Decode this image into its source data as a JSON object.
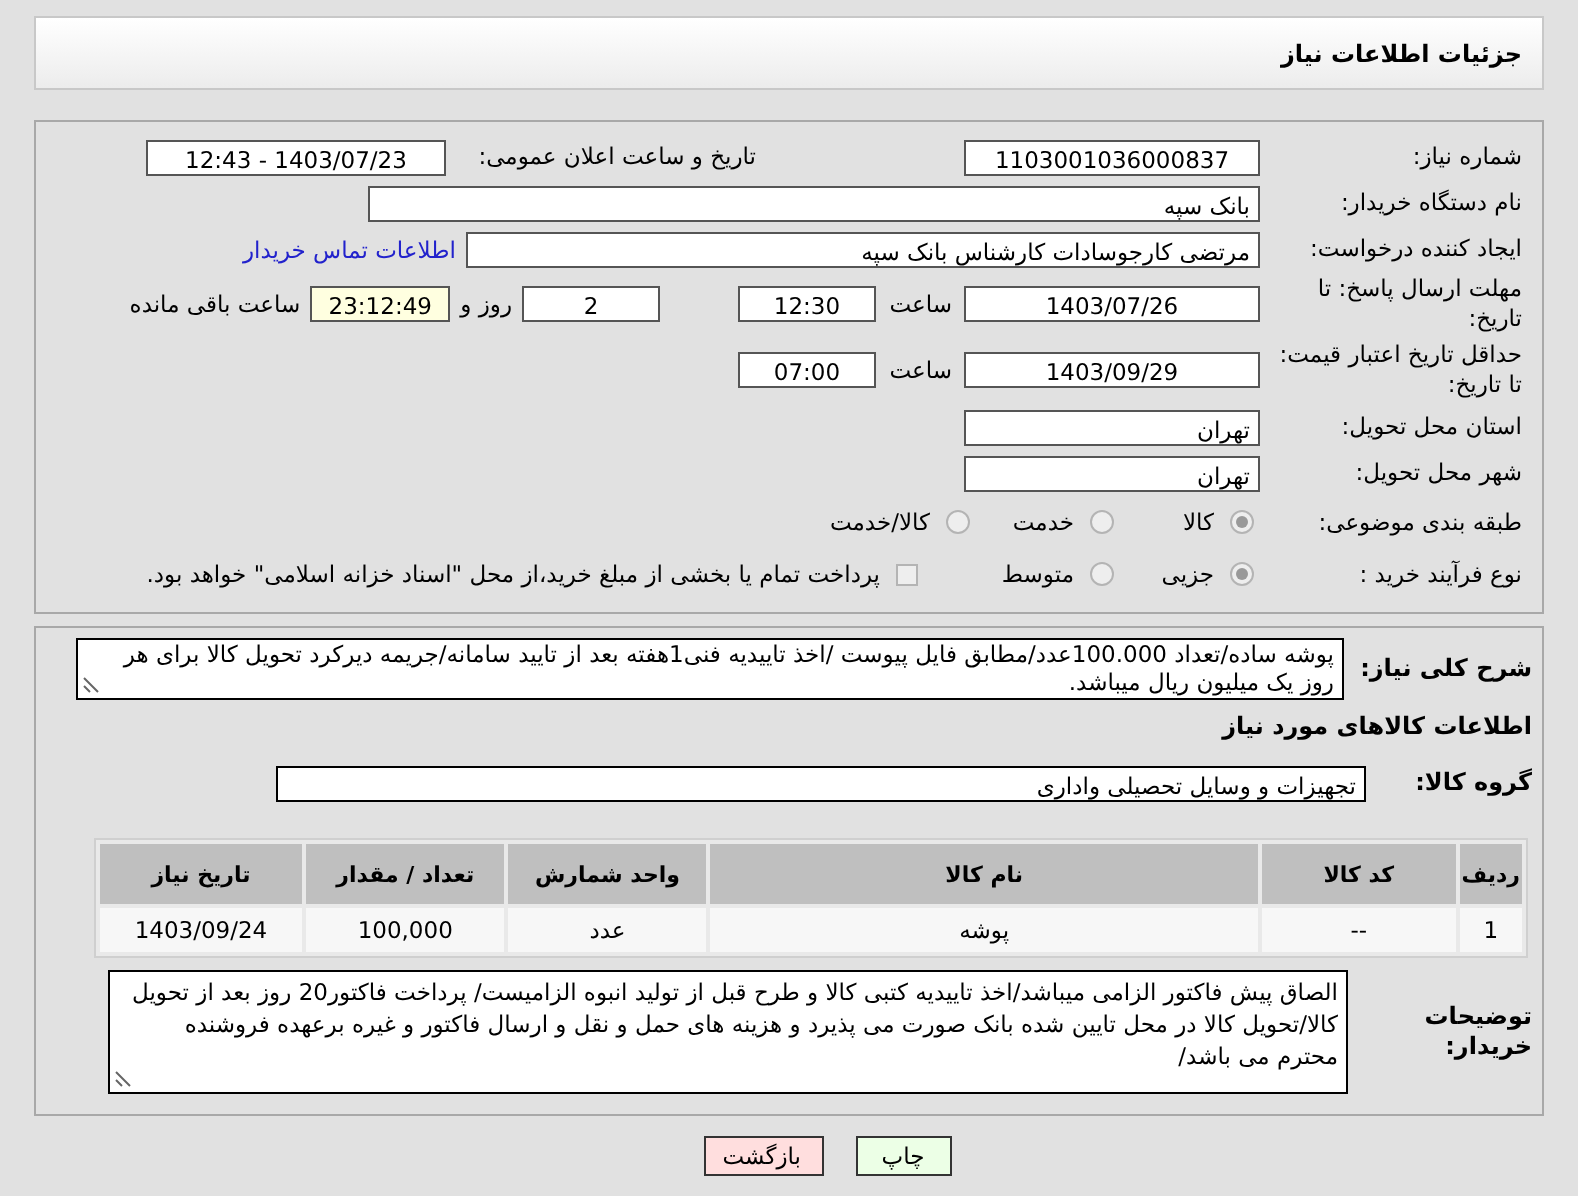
{
  "page_title": "جزئیات اطلاعات نیاز",
  "need_number": {
    "label": "شماره نیاز:",
    "value": "1103001036000837"
  },
  "announce": {
    "label": "تاریخ و ساعت اعلان عمومی:",
    "value": "1403/07/23 - 12:43"
  },
  "buyer_org": {
    "label": "نام دستگاه خریدار:",
    "value": "بانک سپه"
  },
  "requester": {
    "label": "ایجاد کننده درخواست:",
    "value": "مرتضی کارجوسادات کارشناس بانک سپه",
    "link": "اطلاعات تماس خریدار"
  },
  "deadline": {
    "label": "مهلت ارسال پاسخ: تا تاریخ:",
    "date": "1403/07/26",
    "time_label": "ساعت",
    "time": "12:30",
    "days": "2",
    "days_label": "روز و",
    "remaining": "23:12:49",
    "remaining_label": "ساعت باقی مانده"
  },
  "validity": {
    "label": "حداقل تاریخ اعتبار قیمت: تا تاریخ:",
    "date": "1403/09/29",
    "time_label": "ساعت",
    "time": "07:00"
  },
  "province": {
    "label": "استان محل تحویل:",
    "value": "تهران"
  },
  "city": {
    "label": "شهر محل تحویل:",
    "value": "تهران"
  },
  "category": {
    "label": "طبقه بندی موضوعی:",
    "options": [
      {
        "label": "کالا",
        "selected": true
      },
      {
        "label": "خدمت",
        "selected": false
      },
      {
        "label": "کالا/خدمت",
        "selected": false
      }
    ]
  },
  "process": {
    "label": "نوع فرآیند خرید :",
    "options": [
      {
        "label": "جزیی",
        "selected": true
      },
      {
        "label": "متوسط",
        "selected": false
      }
    ],
    "payment_note": {
      "label": "پرداخت تمام یا بخشی از مبلغ خرید،از محل \"اسناد خزانه اسلامی\" خواهد بود.",
      "checked": false
    }
  },
  "description": {
    "label": "شرح کلی نیاز:",
    "value": "پوشه ساده/تعداد 100.000عدد/مطابق فایل پیوست /اخذ تاییدیه فنی1هفته بعد از تایید سامانه/جریمه دیرکرد تحویل کالا برای هر روز یک میلیون ریال میباشد."
  },
  "goods_heading": "اطلاعات کالاهای مورد نیاز",
  "goods_group": {
    "label": "گروه کالا:",
    "value": "تجهیزات و وسایل تحصیلی واداری"
  },
  "table": {
    "columns": [
      "ردیف",
      "کد کالا",
      "نام کالا",
      "واحد شمارش",
      "تعداد / مقدار",
      "تاریخ نیاز"
    ],
    "rows": [
      [
        "1",
        "--",
        "پوشه",
        "عدد",
        "100,000",
        "1403/09/24"
      ]
    ]
  },
  "buyer_notes": {
    "label": "توضیحات خریدار:",
    "value": "الصاق پیش فاکتور الزامی میباشد/اخذ تاییدیه کتبی کالا و طرح قبل از تولید انبوه الزامیست/ پرداخت فاکتور20 روز بعد از تحویل کالا/تحویل کالا در محل تایین شده بانک صورت می پذیرد و هزینه های حمل و نقل و ارسال فاکتور و غیره برعهده فروشنده محترم می باشد/"
  },
  "buttons": [
    {
      "label": "چاپ",
      "kind": "print"
    },
    {
      "label": "بازگشت",
      "kind": "back"
    }
  ]
}
